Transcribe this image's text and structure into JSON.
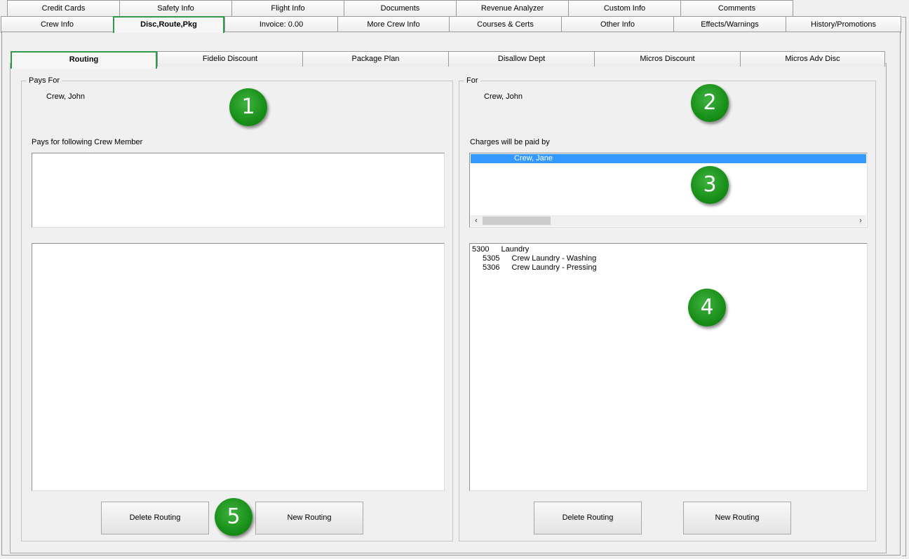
{
  "tabs_row1": [
    {
      "label": "Credit Cards"
    },
    {
      "label": "Safety Info"
    },
    {
      "label": "Flight Info"
    },
    {
      "label": "Documents"
    },
    {
      "label": "Revenue Analyzer"
    },
    {
      "label": "Custom Info"
    },
    {
      "label": "Comments"
    }
  ],
  "tabs_row2": [
    {
      "label": "Crew Info"
    },
    {
      "label": "Disc,Route,Pkg"
    },
    {
      "label": "Invoice: 0.00"
    },
    {
      "label": "More Crew Info"
    },
    {
      "label": "Courses & Certs"
    },
    {
      "label": "Other Info"
    },
    {
      "label": "Effects/Warnings"
    },
    {
      "label": "History/Promotions"
    }
  ],
  "subtabs": [
    {
      "label": "Routing"
    },
    {
      "label": "Fidelio Discount"
    },
    {
      "label": "Package Plan"
    },
    {
      "label": "Disallow Dept"
    },
    {
      "label": "Micros Discount"
    },
    {
      "label": "Micros Adv Disc"
    }
  ],
  "left": {
    "legend": "Pays For",
    "name": "Crew, John",
    "list_label": "Pays for following Crew Member",
    "delete_label": "Delete Routing",
    "new_label": "New Routing"
  },
  "right": {
    "legend": "For",
    "name": "Crew, John",
    "paid_by_label": "Charges will be paid by",
    "paid_by_selected": "Crew, Jane",
    "departments": [
      {
        "code": "5300",
        "name": "Laundry"
      },
      {
        "code": "5305",
        "name": "Crew Laundry - Washing"
      },
      {
        "code": "5306",
        "name": "Crew Laundry - Pressing"
      }
    ],
    "delete_label": "Delete Routing",
    "new_label": "New Routing"
  },
  "badges": [
    "1",
    "2",
    "3",
    "4",
    "5"
  ],
  "colors": {
    "accent": "#2f9a4b",
    "selection": "#3399ff",
    "badge": "#189018"
  }
}
